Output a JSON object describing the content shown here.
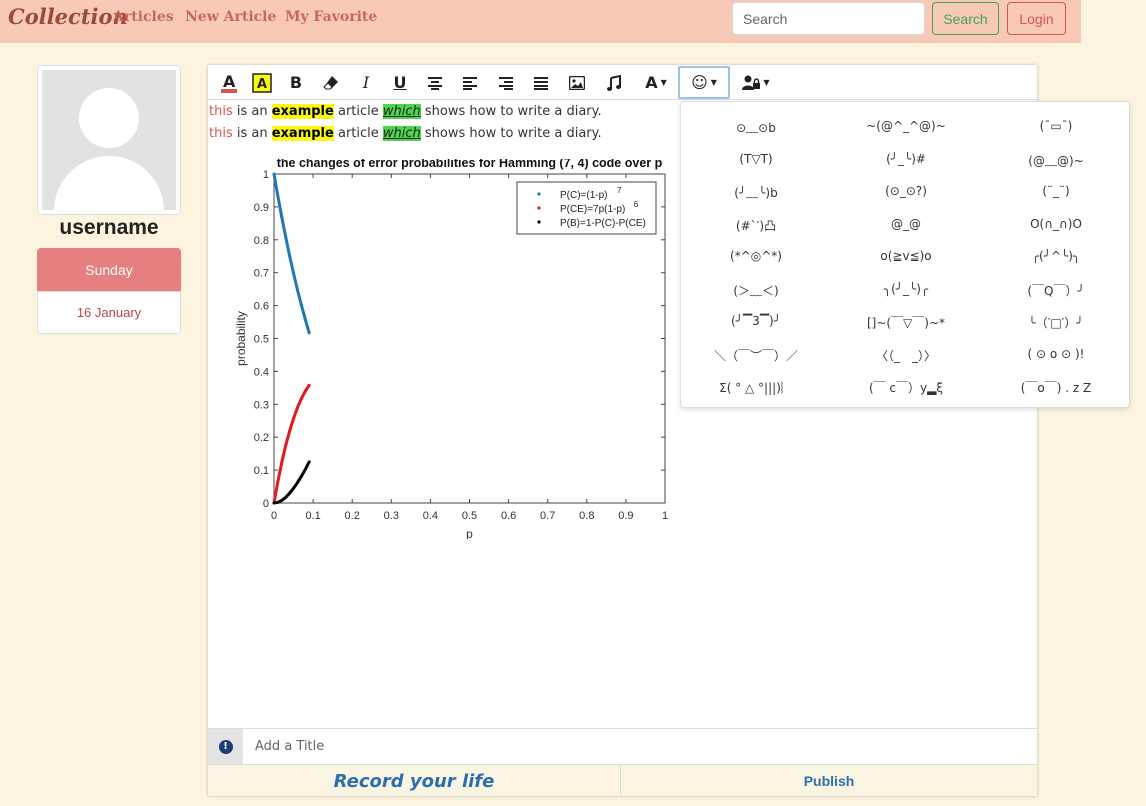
{
  "nav": {
    "brand": "Collection",
    "links": [
      "Articles",
      "New Article",
      "My Favorite"
    ],
    "search_placeholder": "Search",
    "search_button": "Search",
    "login_button": "Login"
  },
  "profile": {
    "username": "username",
    "day": "Sunday",
    "date": "16 January"
  },
  "toolbar": {
    "icons": [
      "font-color-icon",
      "highlight-icon",
      "bold-icon",
      "eraser-icon",
      "italic-icon",
      "underline-icon",
      "align-center-icon",
      "align-left-icon",
      "align-right-icon",
      "align-justify-icon",
      "image-icon",
      "music-icon",
      "font-size-icon",
      "emoji-icon",
      "user-lock-icon"
    ],
    "bold": "B",
    "italic": "I",
    "underline": "U",
    "font_letter": "A"
  },
  "content": {
    "lines": [
      {
        "w1": "this",
        "w2": " is an ",
        "w3": "example",
        "w4": " article ",
        "w5": "which",
        "w6": " shows how to write a diary."
      },
      {
        "w1": "this",
        "w2": " is an ",
        "w3": "example",
        "w4": " article ",
        "w5": "which",
        "w6": " shows how to write a diary."
      }
    ]
  },
  "chart_data": {
    "type": "scatter",
    "title": "the changes of error probabilities for Hamming (7, 4) code over p",
    "xlabel": "p",
    "ylabel": "probability",
    "xlim": [
      0,
      1
    ],
    "ylim": [
      0,
      1
    ],
    "xticks": [
      "0",
      "0.1",
      "0.2",
      "0.3",
      "0.4",
      "0.5",
      "0.6",
      "0.7",
      "0.8",
      "0.9",
      "1"
    ],
    "yticks": [
      "0",
      "0.1",
      "0.2",
      "0.3",
      "0.4",
      "0.5",
      "0.6",
      "0.7",
      "0.8",
      "0.9",
      "1"
    ],
    "legend_position": "top-right",
    "series": [
      {
        "name": "P(C)=(1-p)",
        "sup": "7",
        "color": "#1f77b4",
        "x": [
          0,
          0.01,
          0.02,
          0.03,
          0.04,
          0.05,
          0.06,
          0.07,
          0.08,
          0.09
        ],
        "y": [
          1,
          0.932,
          0.868,
          0.808,
          0.751,
          0.698,
          0.648,
          0.602,
          0.558,
          0.517
        ]
      },
      {
        "name": "P(CE)=7p(1-p)",
        "sup": "6",
        "color": "#e31a1c",
        "x": [
          0,
          0.01,
          0.02,
          0.03,
          0.04,
          0.05,
          0.06,
          0.07,
          0.08,
          0.09
        ],
        "y": [
          0,
          0.066,
          0.124,
          0.175,
          0.219,
          0.257,
          0.29,
          0.317,
          0.34,
          0.358
        ]
      },
      {
        "name": "P(B)=1-P(C)-P(CE)",
        "sup": "",
        "color": "#000000",
        "x": [
          0,
          0.01,
          0.02,
          0.03,
          0.04,
          0.05,
          0.06,
          0.07,
          0.08,
          0.09
        ],
        "y": [
          0,
          0.002,
          0.008,
          0.017,
          0.03,
          0.045,
          0.062,
          0.081,
          0.102,
          0.125
        ]
      }
    ]
  },
  "emoticons": [
    "⊙﹏⊙b",
    "~(@^_^@)~",
    "(¯▭¯)",
    "(T▽T)",
    "(╯_╰)#",
    "(@﹏@)~",
    "(╯﹏╰)b",
    "(⊙_⊙?)",
    "(¨_¨)",
    "(#`′)凸",
    "@_@",
    "O(∩_∩)O",
    "(*^◎^*)",
    "o(≧v≦)o",
    "╭(╯^╰)╮",
    "(＞﹏＜)",
    "╮(╯_╰)╭",
    "(￣Q￣）╯",
    "(╯▔3▔)╯",
    "[]~(￣▽￣)~*",
    "╰（‵□′）╯",
    "＼（￣︶￣）／",
    "〈（_　_）〉",
    "( ⊙ o ⊙ )!",
    "Σ( ° △ °|||)︴",
    "(￣ c￣）y▂ξ",
    "(￣o￣) . z Z"
  ],
  "title_placeholder": "Add a Title",
  "footer": {
    "record": "Record your life",
    "publish": "Publish"
  }
}
